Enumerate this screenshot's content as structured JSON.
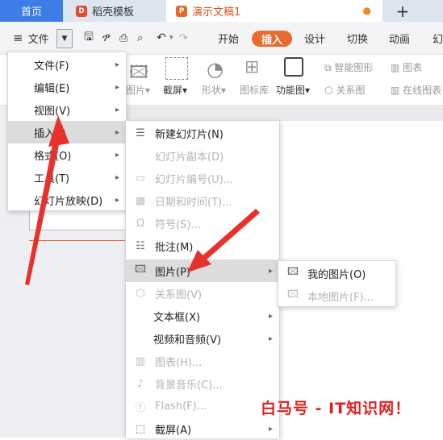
{
  "tabs": {
    "home": "首页",
    "docer": "稻壳模板",
    "presentation": "演示文稿1",
    "new_tab": "+"
  },
  "toolbar": {
    "file": "文件",
    "items": [
      "开始",
      "插入",
      "设计",
      "切换",
      "动画",
      "幻"
    ],
    "active": "插入"
  },
  "ribbon": {
    "picture": "图片",
    "screenshot": "截屏",
    "shape": "形状",
    "icon_lib": "图标库",
    "function_chart": "功能图",
    "smart_shape": "智能图形",
    "chart": "图表",
    "relation": "关系图",
    "online_chart": "在线图表"
  },
  "main_menu": [
    {
      "label": "文件(F)"
    },
    {
      "label": "编辑(E)"
    },
    {
      "label": "视图(V)"
    },
    {
      "label": "插入(I)"
    },
    {
      "label": "格式(O)"
    },
    {
      "label": "工具(T)"
    },
    {
      "label": "幻灯片放映(D)"
    }
  ],
  "insert_menu": [
    {
      "label": "新建幻灯片(N)",
      "icon": "new-slide-icon"
    },
    {
      "label": "幻灯片副本(D)",
      "icon": ""
    },
    {
      "label": "幻灯片编号(U)...",
      "icon": "slide-number-icon"
    },
    {
      "label": "日期和时间(T)...",
      "icon": "calendar-icon"
    },
    {
      "label": "符号(S)...",
      "icon": "symbol-icon"
    },
    {
      "label": "批注(M)",
      "icon": "comment-icon"
    },
    {
      "label": "图片(P)",
      "icon": "picture-icon"
    },
    {
      "label": "关系图(V)",
      "icon": "relation-icon"
    },
    {
      "label": "文本框(X)",
      "icon": ""
    },
    {
      "label": "视频和音频(V)",
      "icon": ""
    },
    {
      "label": "图表(H)...",
      "icon": "chart-icon"
    },
    {
      "label": "背景音乐(C)...",
      "icon": "music-icon"
    },
    {
      "label": "Flash(F)...",
      "icon": "flash-icon"
    },
    {
      "label": "截屏(A)",
      "icon": "screenshot-icon"
    }
  ],
  "picture_menu": [
    {
      "label": "我的图片(O)",
      "icon": "my-pictures-icon"
    },
    {
      "label": "本地图片(F)...",
      "icon": "local-picture-icon"
    }
  ],
  "watermark": "白马号 - IT知识网！"
}
